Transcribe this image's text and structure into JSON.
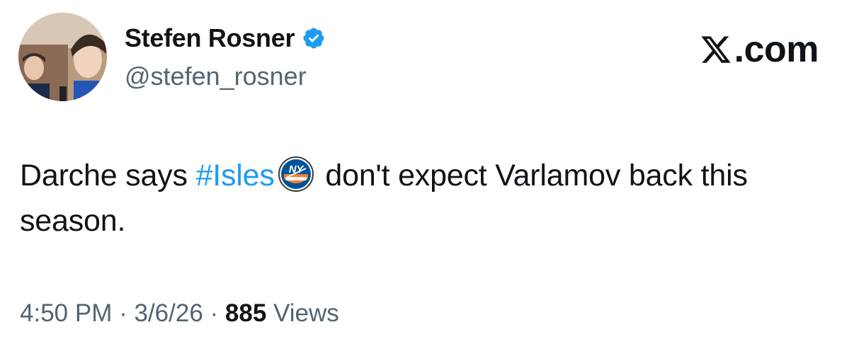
{
  "author": {
    "display_name": "Stefen Rosner",
    "handle": "@stefen_rosner",
    "verified": true
  },
  "brand": {
    "label": ".com"
  },
  "tweet": {
    "text_before": "Darche says ",
    "hashtag": "#Isles",
    "emoji": "new-york-islanders-logo-icon",
    "text_after": " don't expect Varlamov back this season."
  },
  "meta": {
    "time": "4:50 PM",
    "date": "3/6/26",
    "views_count": "885",
    "views_label": "Views",
    "separator": "·"
  },
  "colors": {
    "text": "#0f1419",
    "secondary": "#536471",
    "link": "#1d9bf0",
    "verified": "#1d9bf0",
    "islanders_blue": "#00539b",
    "islanders_orange": "#f47d30"
  }
}
